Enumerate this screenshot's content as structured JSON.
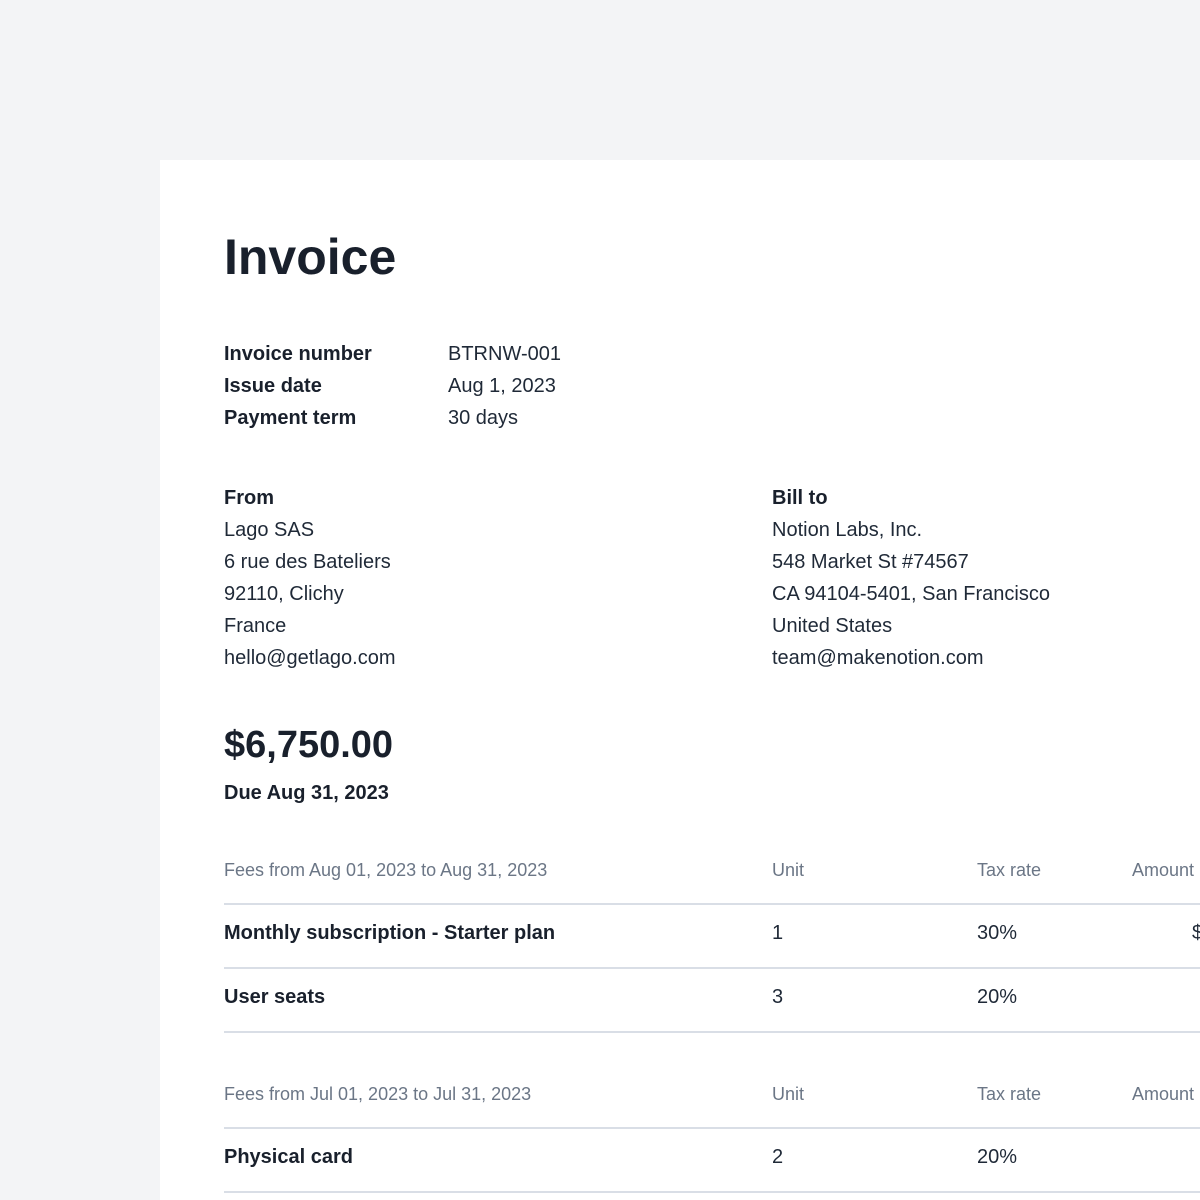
{
  "invoice": {
    "title": "Invoice",
    "meta": [
      {
        "label": "Invoice number",
        "value": "BTRNW-001"
      },
      {
        "label": "Issue date",
        "value": "Aug 1, 2023"
      },
      {
        "label": "Payment term",
        "value": "30 days"
      }
    ],
    "from": {
      "label": "From",
      "lines": [
        "Lago SAS",
        "6 rue des Bateliers",
        "92110, Clichy",
        "France",
        "hello@getlago.com"
      ]
    },
    "bill_to": {
      "label": "Bill to",
      "lines": [
        "Notion Labs, Inc.",
        "548 Market St #74567",
        "CA 94104-5401, San Francisco",
        "United States",
        "team@makenotion.com"
      ]
    },
    "total": "$6,750.00",
    "due": "Due Aug 31, 2023",
    "fee_groups": [
      {
        "header": {
          "period": "Fees from Aug 01, 2023 to Aug 31, 2023",
          "unit": "Unit",
          "tax_rate": "Tax rate",
          "amount": "Amount"
        },
        "rows": [
          {
            "name": "Monthly subscription - Starter plan",
            "unit": "1",
            "tax_rate": "30%",
            "amount": "$"
          },
          {
            "name": "User seats",
            "unit": "3",
            "tax_rate": "20%",
            "amount": ""
          }
        ]
      },
      {
        "header": {
          "period": "Fees from Jul 01, 2023 to Jul 31, 2023",
          "unit": "Unit",
          "tax_rate": "Tax rate",
          "amount": "Amount"
        },
        "rows": [
          {
            "name": "Physical card",
            "unit": "2",
            "tax_rate": "20%",
            "amount": ""
          }
        ]
      }
    ]
  }
}
